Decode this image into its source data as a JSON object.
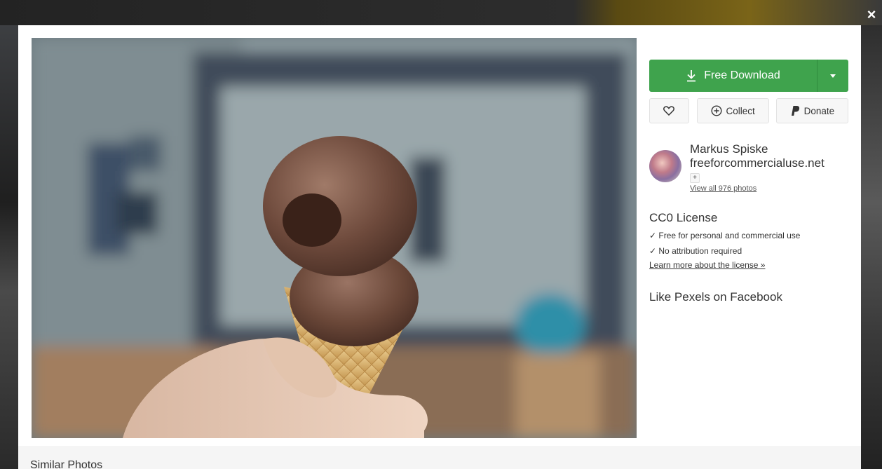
{
  "download": {
    "label": "Free Download"
  },
  "actions": {
    "collect": "Collect",
    "donate": "Donate"
  },
  "author": {
    "name": "Markus Spiske",
    "site": "freeforcommercialuse.net",
    "follow": "+",
    "view_all": "View all 976 photos"
  },
  "license": {
    "title": "CC0 License",
    "items": [
      "✓ Free for personal and commercial use",
      "✓ No attribution required"
    ],
    "link": "Learn more about the license »"
  },
  "facebook": {
    "title": "Like Pexels on Facebook"
  },
  "similar": {
    "title": "Similar Photos"
  },
  "close": "×",
  "colors": {
    "accent": "#3fa34d"
  }
}
